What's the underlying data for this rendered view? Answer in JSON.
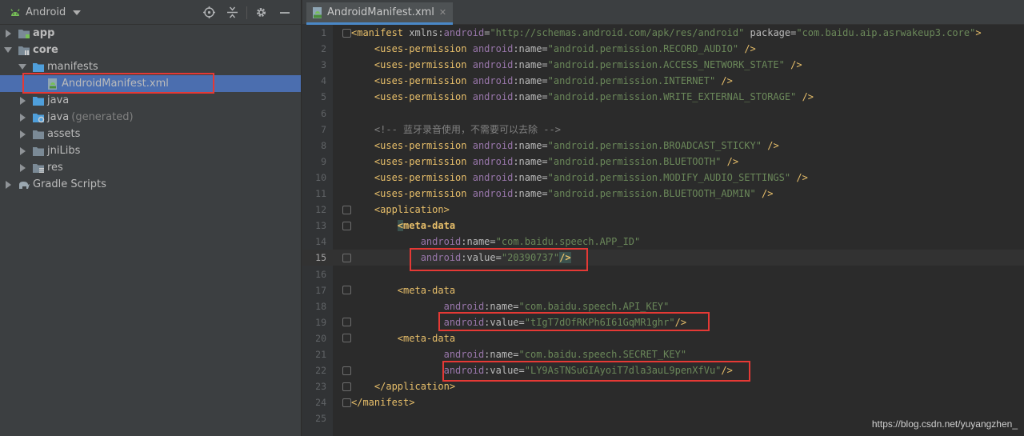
{
  "project_panel": {
    "view_label": "Android",
    "items": [
      {
        "label": "app",
        "bold": true
      },
      {
        "label": "core",
        "bold": true
      },
      {
        "label": "manifests"
      },
      {
        "label": "AndroidManifest.xml"
      },
      {
        "label": "java"
      },
      {
        "label": "java",
        "suffix": "(generated)"
      },
      {
        "label": "assets"
      },
      {
        "label": "jniLibs"
      },
      {
        "label": "res"
      },
      {
        "label": "Gradle Scripts"
      }
    ]
  },
  "editor": {
    "tab_label": "AndroidManifest.xml",
    "current_line": 15,
    "lines": [
      {
        "n": "1",
        "parts": [
          [
            "p",
            "<"
          ],
          [
            "t",
            "manifest "
          ],
          [
            "a",
            "xmlns:"
          ],
          [
            "ns",
            "android"
          ],
          [
            "a",
            "="
          ],
          [
            "v",
            "\"http://schemas.android.com/apk/res/android\" "
          ],
          [
            "a",
            "package"
          ],
          [
            "a",
            "="
          ],
          [
            "v",
            "\"com.baidu.aip.asrwakeup3.core\""
          ],
          [
            "p",
            ">"
          ]
        ]
      },
      {
        "n": "2",
        "parts": [
          [
            "s",
            "    "
          ],
          [
            "p",
            "<"
          ],
          [
            "t",
            "uses-permission "
          ],
          [
            "ns",
            "android"
          ],
          [
            "a",
            ":name="
          ],
          [
            "v",
            "\"android.permission.RECORD_AUDIO\" "
          ],
          [
            "p",
            "/>"
          ]
        ]
      },
      {
        "n": "3",
        "parts": [
          [
            "s",
            "    "
          ],
          [
            "p",
            "<"
          ],
          [
            "t",
            "uses-permission "
          ],
          [
            "ns",
            "android"
          ],
          [
            "a",
            ":name="
          ],
          [
            "v",
            "\"android.permission.ACCESS_NETWORK_STATE\" "
          ],
          [
            "p",
            "/>"
          ]
        ]
      },
      {
        "n": "4",
        "parts": [
          [
            "s",
            "    "
          ],
          [
            "p",
            "<"
          ],
          [
            "t",
            "uses-permission "
          ],
          [
            "ns",
            "android"
          ],
          [
            "a",
            ":name="
          ],
          [
            "v",
            "\"android.permission.INTERNET\" "
          ],
          [
            "p",
            "/>"
          ]
        ]
      },
      {
        "n": "5",
        "parts": [
          [
            "s",
            "    "
          ],
          [
            "p",
            "<"
          ],
          [
            "t",
            "uses-permission "
          ],
          [
            "ns",
            "android"
          ],
          [
            "a",
            ":name="
          ],
          [
            "v",
            "\"android.permission.WRITE_EXTERNAL_STORAGE\" "
          ],
          [
            "p",
            "/>"
          ]
        ]
      },
      {
        "n": "6",
        "parts": []
      },
      {
        "n": "7",
        "parts": [
          [
            "s",
            "    "
          ],
          [
            "c",
            "<!-- 蓝牙录音使用，不需要可以去除 -->"
          ]
        ]
      },
      {
        "n": "8",
        "parts": [
          [
            "s",
            "    "
          ],
          [
            "p",
            "<"
          ],
          [
            "t",
            "uses-permission "
          ],
          [
            "ns",
            "android"
          ],
          [
            "a",
            ":name="
          ],
          [
            "v",
            "\"android.permission.BROADCAST_STICKY\" "
          ],
          [
            "p",
            "/>"
          ]
        ]
      },
      {
        "n": "9",
        "parts": [
          [
            "s",
            "    "
          ],
          [
            "p",
            "<"
          ],
          [
            "t",
            "uses-permission "
          ],
          [
            "ns",
            "android"
          ],
          [
            "a",
            ":name="
          ],
          [
            "v",
            "\"android.permission.BLUETOOTH\" "
          ],
          [
            "p",
            "/>"
          ]
        ]
      },
      {
        "n": "10",
        "parts": [
          [
            "s",
            "    "
          ],
          [
            "p",
            "<"
          ],
          [
            "t",
            "uses-permission "
          ],
          [
            "ns",
            "android"
          ],
          [
            "a",
            ":name="
          ],
          [
            "v",
            "\"android.permission.MODIFY_AUDIO_SETTINGS\" "
          ],
          [
            "p",
            "/>"
          ]
        ]
      },
      {
        "n": "11",
        "parts": [
          [
            "s",
            "    "
          ],
          [
            "p",
            "<"
          ],
          [
            "t",
            "uses-permission "
          ],
          [
            "ns",
            "android"
          ],
          [
            "a",
            ":name="
          ],
          [
            "v",
            "\"android.permission.BLUETOOTH_ADMIN\" "
          ],
          [
            "p",
            "/>"
          ]
        ]
      },
      {
        "n": "12",
        "parts": [
          [
            "s",
            "    "
          ],
          [
            "p",
            "<"
          ],
          [
            "t",
            "application"
          ],
          [
            "p",
            ">"
          ]
        ]
      },
      {
        "n": "13",
        "parts": [
          [
            "s",
            "        "
          ],
          [
            "m",
            "<"
          ],
          [
            "tb",
            "meta-data"
          ]
        ]
      },
      {
        "n": "14",
        "parts": [
          [
            "s",
            "            "
          ],
          [
            "ns",
            "android"
          ],
          [
            "a",
            ":name="
          ],
          [
            "v",
            "\"com.baidu.speech.APP_ID\""
          ]
        ]
      },
      {
        "n": "15",
        "parts": [
          [
            "s",
            "            "
          ],
          [
            "ns",
            "android"
          ],
          [
            "a",
            ":value="
          ],
          [
            "v",
            "\"20390737\""
          ],
          [
            "m",
            "/>"
          ]
        ]
      },
      {
        "n": "16",
        "parts": []
      },
      {
        "n": "17",
        "parts": [
          [
            "s",
            "        "
          ],
          [
            "p",
            "<"
          ],
          [
            "t",
            "meta-data"
          ]
        ]
      },
      {
        "n": "18",
        "parts": [
          [
            "s",
            "                "
          ],
          [
            "ns",
            "android"
          ],
          [
            "a",
            ":name="
          ],
          [
            "v",
            "\"com.baidu.speech.API_KEY\""
          ]
        ]
      },
      {
        "n": "19",
        "parts": [
          [
            "s",
            "                "
          ],
          [
            "ns",
            "android"
          ],
          [
            "a",
            ":value="
          ],
          [
            "v",
            "\"tIgT7dOfRKPh6I61GqMR1ghr\""
          ],
          [
            "p",
            "/>"
          ]
        ]
      },
      {
        "n": "20",
        "parts": [
          [
            "s",
            "        "
          ],
          [
            "p",
            "<"
          ],
          [
            "t",
            "meta-data"
          ]
        ]
      },
      {
        "n": "21",
        "parts": [
          [
            "s",
            "                "
          ],
          [
            "ns",
            "android"
          ],
          [
            "a",
            ":name="
          ],
          [
            "v",
            "\"com.baidu.speech.SECRET_KEY\""
          ]
        ]
      },
      {
        "n": "22",
        "parts": [
          [
            "s",
            "                "
          ],
          [
            "ns",
            "android"
          ],
          [
            "a",
            ":value="
          ],
          [
            "v",
            "\"LY9AsTNSuGIAyoiT7dla3auL9penXfVu\""
          ],
          [
            "p",
            "/>"
          ]
        ]
      },
      {
        "n": "23",
        "parts": [
          [
            "s",
            "    "
          ],
          [
            "p",
            "</"
          ],
          [
            "t",
            "application"
          ],
          [
            "p",
            ">"
          ]
        ]
      },
      {
        "n": "24",
        "parts": [
          [
            "p",
            "</"
          ],
          [
            "t",
            "manifest"
          ],
          [
            "p",
            ">"
          ]
        ]
      },
      {
        "n": "25",
        "parts": []
      }
    ]
  },
  "watermark": "https://blog.csdn.net/yuyangzhen_",
  "colors": {
    "selection": "#4b6eaf",
    "annotation": "#e53935",
    "tag": "#e8bf6a",
    "namespace": "#9876aa",
    "string": "#6a8759",
    "comment": "#808080"
  }
}
